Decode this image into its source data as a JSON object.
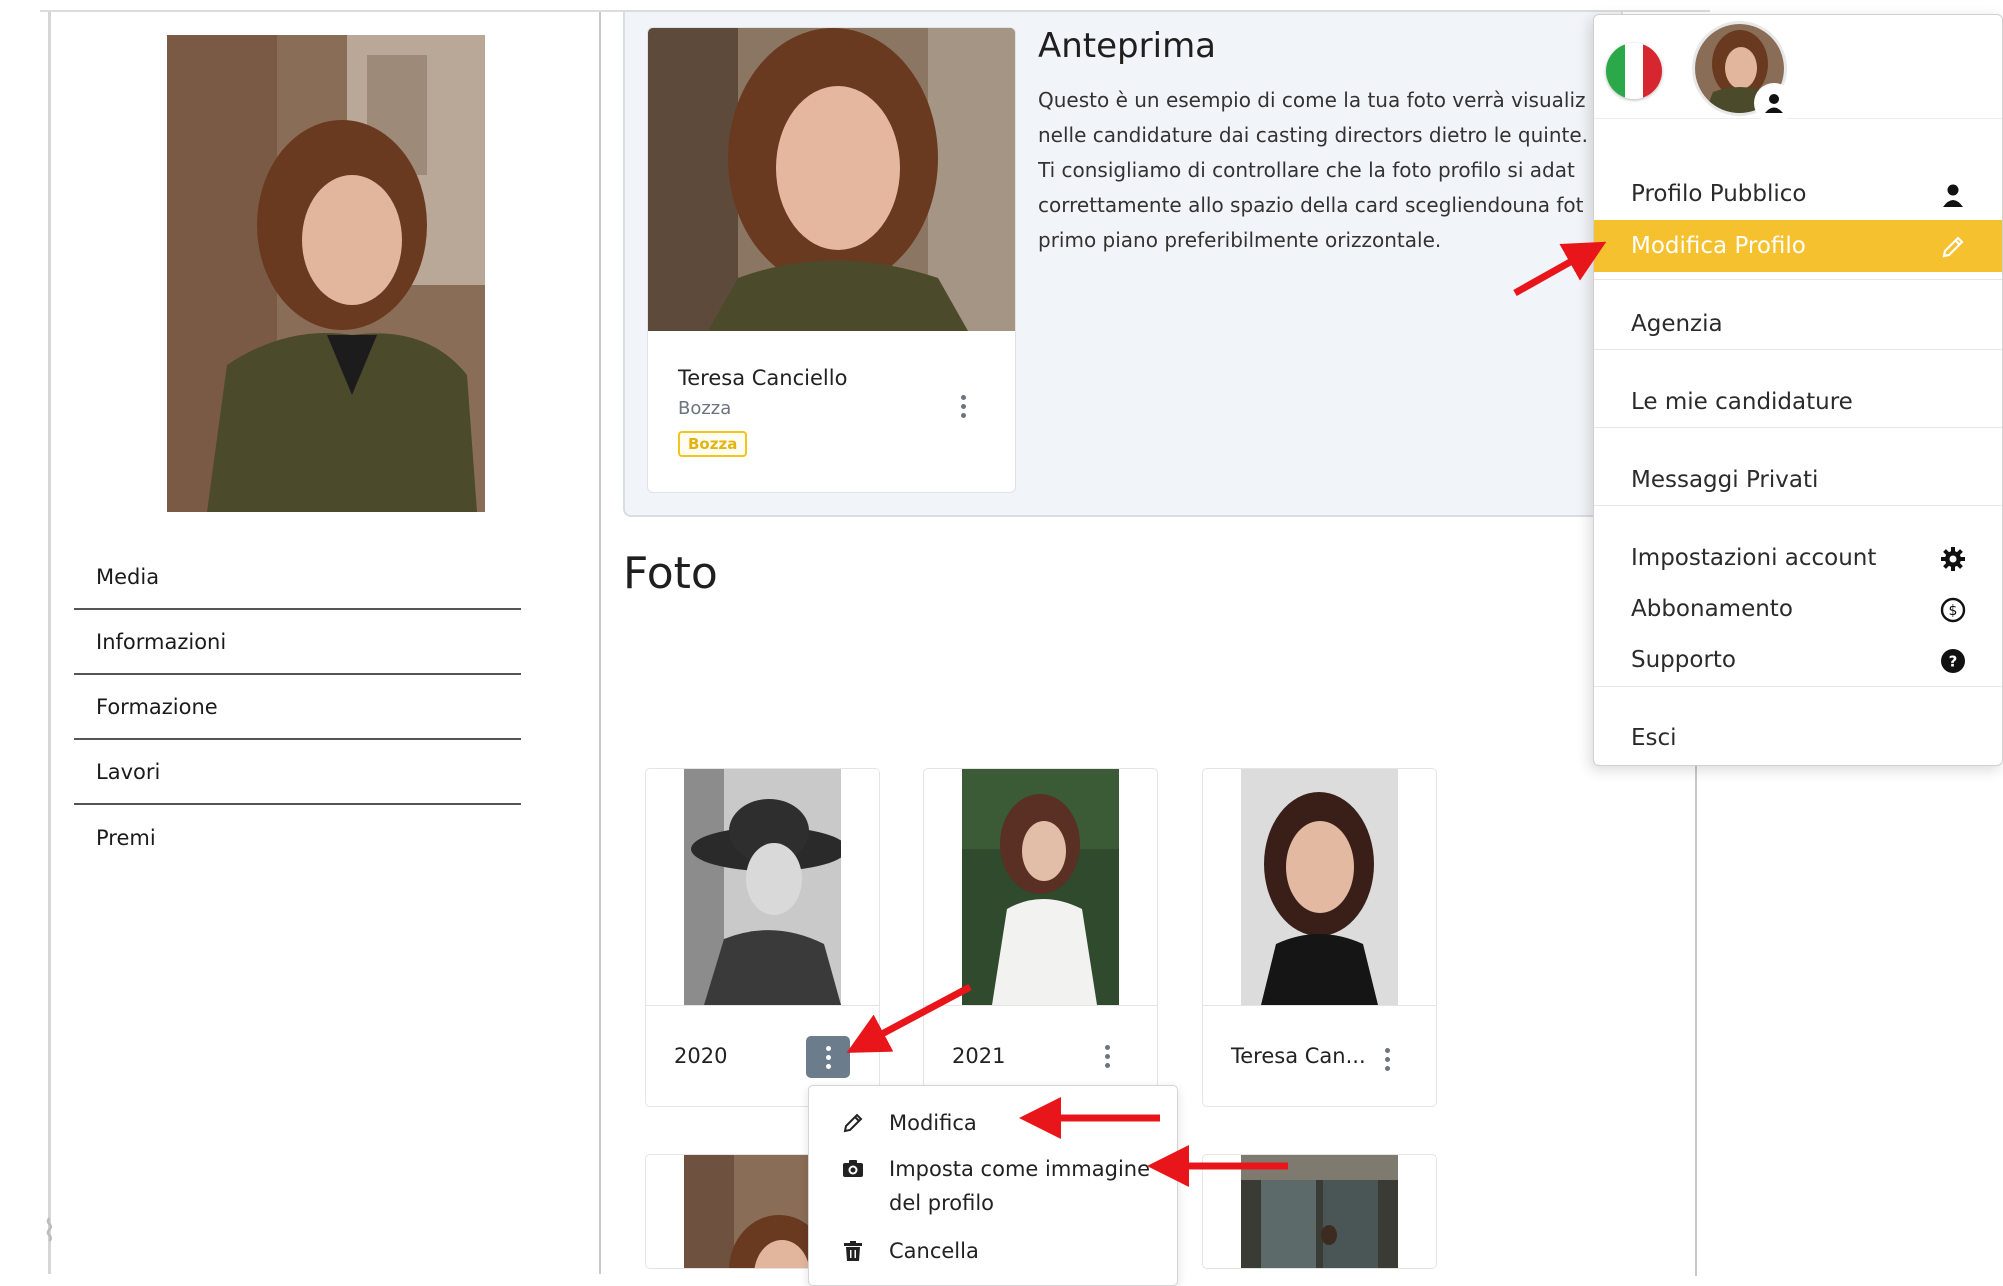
{
  "side_nav": {
    "items": [
      "Media",
      "Informazioni",
      "Formazione",
      "Lavori",
      "Premi"
    ]
  },
  "preview": {
    "title": "Anteprima",
    "lines": [
      "Questo è un esempio di come la tua foto verrà visualiz",
      "nelle candidature dai casting directors dietro le quinte.",
      "Ti consigliamo di controllare che la foto profilo si adat",
      "correttamente allo spazio della card scegliendouna fot",
      "primo piano preferibilmente orizzontale."
    ],
    "card": {
      "name": "Teresa Canciello",
      "subtitle": "Bozza",
      "badge": "Bozza"
    }
  },
  "foto": {
    "title": "Foto",
    "cards": [
      {
        "caption": "2020"
      },
      {
        "caption": "2021"
      },
      {
        "caption": "Teresa Can..."
      }
    ]
  },
  "context_menu": {
    "items": [
      {
        "label": "Modifica",
        "icon": "pencil-icon"
      },
      {
        "label": "Imposta come immagine del profilo",
        "label_line1": "Imposta come immagine",
        "label_line2": "del profilo",
        "icon": "camera-icon"
      },
      {
        "label": "Cancella",
        "icon": "trash-icon"
      }
    ]
  },
  "user_menu": {
    "items": [
      {
        "label": "Profilo Pubblico",
        "icon": "user-icon"
      },
      {
        "label": "Modifica Profilo",
        "icon": "pencil-icon",
        "active": true
      },
      {
        "label": "Agenzia"
      },
      {
        "label": "Le mie candidature"
      },
      {
        "label": "Messaggi Privati"
      },
      {
        "label": "Impostazioni account",
        "icon": "gear-icon"
      },
      {
        "label": "Abbonamento",
        "icon": "dollar-circle-icon"
      },
      {
        "label": "Supporto",
        "icon": "question-circle-icon"
      },
      {
        "label": "Esci"
      }
    ]
  },
  "colors": {
    "accent": "#f5c12e",
    "badge_text": "#e5b310",
    "arrow": "#e8161b",
    "active_kebab": "#6b7d8c",
    "preview_bg": "#f1f4f8"
  }
}
